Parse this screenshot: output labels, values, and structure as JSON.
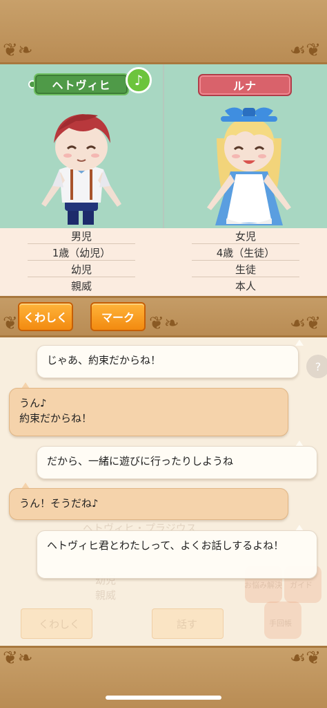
{
  "characters": {
    "left": {
      "name": "ヘトヴィヒ",
      "gender": "男児",
      "age": "1歳（幼児）",
      "stage": "幼児",
      "relation": "親威"
    },
    "right": {
      "name": "ルナ",
      "gender": "女児",
      "age": "4歳（生徒）",
      "stage": "生徒",
      "relation": "本人"
    },
    "music_badge": "♪"
  },
  "buttons": {
    "details": "くわしく",
    "mark": "マーク"
  },
  "dialogue": [
    {
      "speaker": "left",
      "text": "じゃあ、約束だからね！"
    },
    {
      "speaker": "right",
      "text": "うん♪\n約束だからね！"
    },
    {
      "speaker": "left",
      "text": "だから、一緒に遊びに行ったりしようね"
    },
    {
      "speaker": "right",
      "text": "うん！そうだね♪"
    },
    {
      "speaker": "left",
      "text": "ヘトヴィヒ君とわたしって、よくお話しするよね！"
    }
  ],
  "background_ghost": {
    "name_line": "ヘトヴィヒ・プラジウス",
    "stage": "幼児",
    "relation": "親威",
    "details_button": "くわしく",
    "talk_button": "話す",
    "guide": "ガイド",
    "item1": "お悩み解決",
    "item2": "手回帳"
  },
  "colors": {
    "wood": "#b98c54",
    "mint": "#a8d7c2",
    "name_green": "#4f9a48",
    "name_red": "#d9626b",
    "orange_button": "#f28a10",
    "bubble_peach": "#f5d3ab"
  },
  "icons": [
    "music-note-icon",
    "help-icon"
  ]
}
